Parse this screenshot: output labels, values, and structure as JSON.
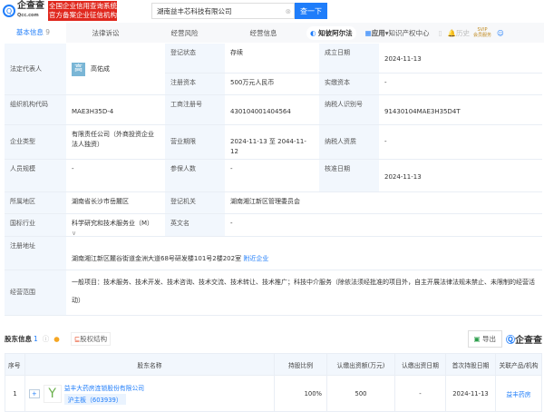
{
  "header": {
    "logo_main": "企查查",
    "logo_sub": "Qcc.com",
    "ad_line1": "全国企业信用查询系统",
    "ad_line2": "官方备案企业征信机构",
    "search_value": "湖南益丰芯科技有限公司",
    "search_button": "查一下"
  },
  "nav": {
    "tabs": [
      {
        "label": "基本信息",
        "count": "9"
      },
      {
        "label": "法律诉讼"
      },
      {
        "label": "经营风险"
      },
      {
        "label": "经营信息"
      }
    ],
    "zhibi": "知彼阿尔法",
    "app": "应用",
    "ip": "知识产权中心",
    "history": "历史",
    "svip": "SVIP",
    "svip_sub": "会员服务"
  },
  "info": {
    "legal_rep_label": "法定代表人",
    "legal_rep_avatar": "高",
    "legal_rep": "高佑成",
    "status_label": "登记状态",
    "status": "存续",
    "found_label": "成立日期",
    "found": "2024-11-13",
    "capital_label": "注册资本",
    "capital": "500万元人民币",
    "paid_label": "实缴资本",
    "paid": "-",
    "org_label": "组织机构代码",
    "org": "MAE3H35D-4",
    "reg_label": "工商注册号",
    "reg": "430104001404564",
    "tax_label": "纳税人识别号",
    "tax": "91430104MAE3H35D4T",
    "type_label": "企业类型",
    "type": "有限责任公司（外商投资企业法人独资）",
    "term_label": "营业期限",
    "term": "2024-11-13 至 2044-11-12",
    "taxq_label": "纳税人资质",
    "taxq": "-",
    "staff_label": "人员规模",
    "staff": "-",
    "insured_label": "参保人数",
    "insured": "-",
    "approve_label": "核准日期",
    "approve": "2024-11-13",
    "region_label": "所属地区",
    "region": "湖南省长沙市岳麓区",
    "authority_label": "登记机关",
    "authority": "湖南湘江新区管理委员会",
    "industry_label": "国标行业",
    "industry": "科学研究和技术服务业（M）",
    "en_label": "英文名",
    "en": "-",
    "addr_label": "注册地址",
    "addr": "湖南湘江新区麓谷街道金洲大道68号研发楼101号2楼202室",
    "nearby": "附近企业",
    "scope_label": "经营范围",
    "scope": "一般项目：技术服务、技术开发、技术咨询、技术交流、技术转让、技术推广；科技中介服务（除依法须经批准的项目外，自主开展法律法规未禁止、未限制的经营活动）"
  },
  "shareholders": {
    "title": "股东信息",
    "count": "1",
    "structure": "股权结构",
    "export": "导出",
    "brand": "企查查",
    "columns": [
      "序号",
      "股东名称",
      "持股比例",
      "认缴出资额(万元)",
      "认缴出资日期",
      "首次持股日期",
      "关联产品/机构"
    ],
    "rows": [
      {
        "no": "1",
        "name": "益丰大药房连锁股份有限公司",
        "tag": "沪主板（603939）",
        "ratio": "100%",
        "amount": "500",
        "date": "-",
        "first": "2024-11-13",
        "product": "益丰药房"
      }
    ]
  }
}
